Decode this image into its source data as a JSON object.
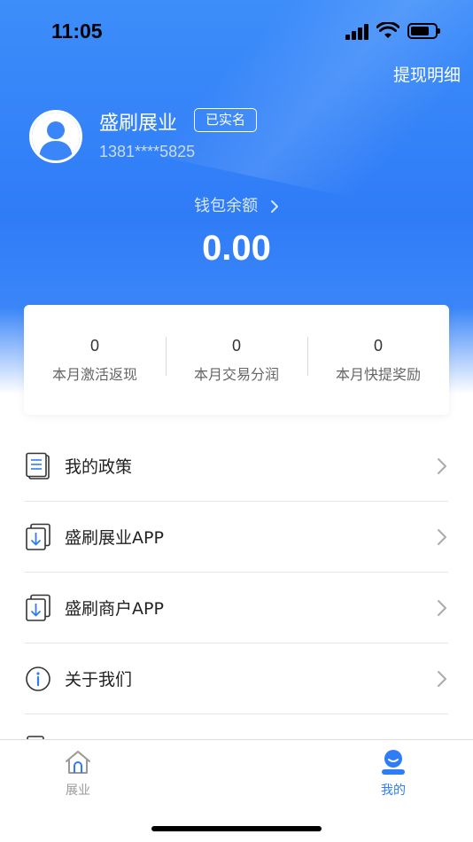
{
  "status_bar": {
    "time": "11:05"
  },
  "header": {
    "withdraw_detail": "提现明细",
    "user_name": "盛刷展业",
    "verified_badge": "已实名",
    "phone": "1381****5825",
    "wallet_label": "钱包余额",
    "wallet_amount": "0.00"
  },
  "stats": [
    {
      "value": "0",
      "label": "本月激活返现"
    },
    {
      "value": "0",
      "label": "本月交易分润"
    },
    {
      "value": "0",
      "label": "本月快提奖励"
    }
  ],
  "menu": [
    {
      "label": "我的政策",
      "icon": "document-list-icon"
    },
    {
      "label": "盛刷展业APP",
      "icon": "download-copy-icon"
    },
    {
      "label": "盛刷商户APP",
      "icon": "download-copy-icon"
    },
    {
      "label": "关于我们",
      "icon": "info-icon"
    }
  ],
  "tabbar": {
    "home": {
      "label": "展业",
      "icon": "home-icon"
    },
    "mine": {
      "label": "我的",
      "icon": "user-icon"
    }
  },
  "colors": {
    "primary": "#2f7cf7",
    "tab_active": "#2f7cf7",
    "tab_inactive": "#999999"
  }
}
